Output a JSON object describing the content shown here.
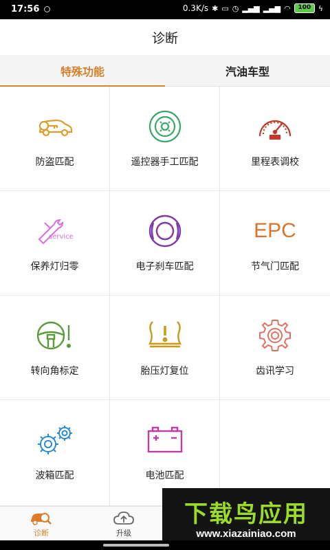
{
  "status_bar": {
    "time": "17:56",
    "speed": "0.3K/s",
    "battery": "100"
  },
  "header": {
    "title": "诊断"
  },
  "tabs": [
    {
      "label": "特殊功能",
      "active": true
    },
    {
      "label": "汽油车型",
      "active": false
    }
  ],
  "functions": [
    {
      "label": "防盗匹配",
      "icon": "car-key-icon",
      "color": "#d9a02b"
    },
    {
      "label": "遥控器手工匹配",
      "icon": "remote-control-icon",
      "color": "#3aa865"
    },
    {
      "label": "里程表调校",
      "icon": "speedometer-icon",
      "color": "#c0392b"
    },
    {
      "label": "保养灯归零",
      "icon": "service-wrench-icon",
      "color": "#d86ee0",
      "icon_text": "service"
    },
    {
      "label": "电子刹车匹配",
      "icon": "brake-disc-icon",
      "color": "#7b3aa8"
    },
    {
      "label": "节气门匹配",
      "icon": "epc-icon",
      "color": "#d9752b",
      "icon_text": "EPC"
    },
    {
      "label": "转向角标定",
      "icon": "steering-wheel-icon",
      "color": "#5a9a3a"
    },
    {
      "label": "胎压灯复位",
      "icon": "tire-pressure-icon",
      "color": "#c99a1a"
    },
    {
      "label": "齿讯学习",
      "icon": "gear-icon",
      "color": "#e07060"
    },
    {
      "label": "波箱匹配",
      "icon": "gears-icon",
      "color": "#2a8ad0"
    },
    {
      "label": "电池匹配",
      "icon": "battery-icon",
      "color": "#c03aa8"
    }
  ],
  "bottom_nav": [
    {
      "label": "诊断",
      "icon": "car-search-icon",
      "active": true
    },
    {
      "label": "升级",
      "icon": "cloud-upload-icon",
      "active": false
    }
  ],
  "watermark": {
    "title": "下载鸟应用",
    "url": "www.xiazainiao.com"
  }
}
